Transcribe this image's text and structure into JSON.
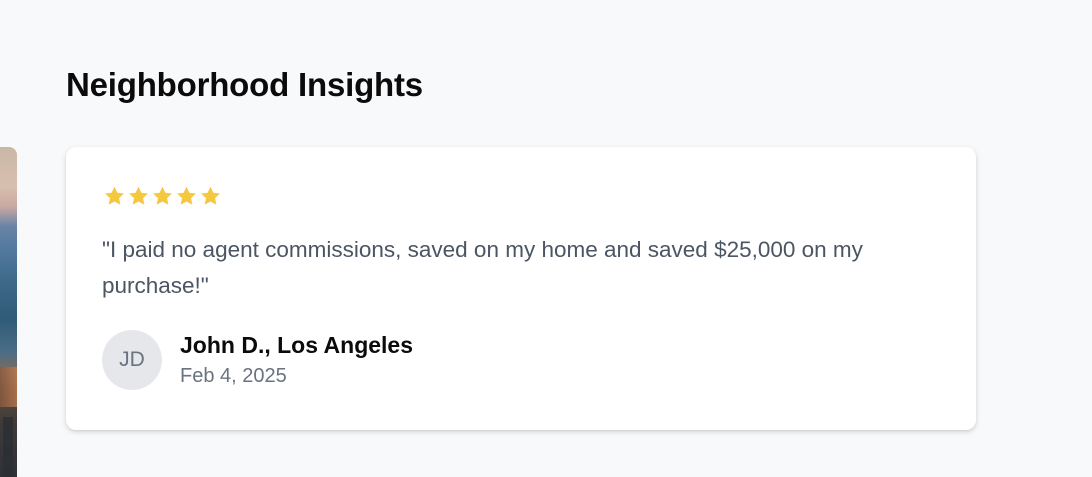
{
  "section": {
    "title": "Neighborhood Insights"
  },
  "review": {
    "rating": 5,
    "max_rating": 5,
    "star_color": "#f5c842",
    "quote": "\"I paid no agent commissions, saved on my home and saved $25,000 on my purchase!\"",
    "author": {
      "initials": "JD",
      "name": "John D., Los Angeles",
      "date": "Feb 4, 2025"
    }
  },
  "side_image": {
    "icon": "city-skyline-photo"
  }
}
